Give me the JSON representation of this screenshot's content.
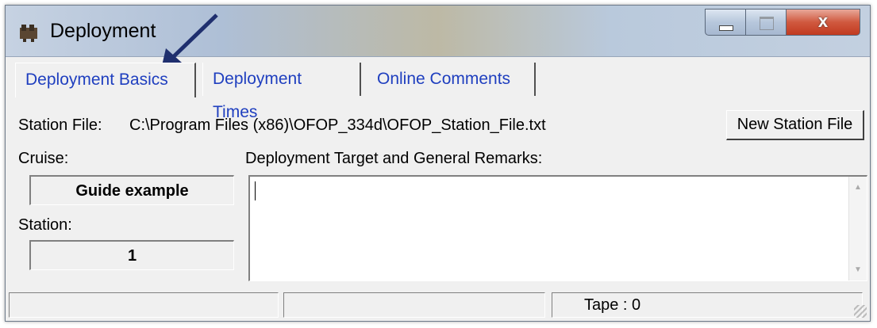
{
  "window": {
    "title": "Deployment",
    "controls": {
      "minimize": "minimize",
      "maximize": "maximize",
      "close": "x"
    }
  },
  "tabs": [
    {
      "label": "Deployment Basics",
      "active": true
    },
    {
      "label": "Deployment Times",
      "active": false
    },
    {
      "label": "Online Comments",
      "active": false
    }
  ],
  "station_file": {
    "label": "Station File:",
    "path": "C:\\Program Files (x86)\\OFOP_334d\\OFOP_Station_File.txt",
    "button": "New Station File"
  },
  "cruise": {
    "label": "Cruise:",
    "value": "Guide example"
  },
  "station": {
    "label": "Station:",
    "value": "1"
  },
  "remarks": {
    "label": "Deployment Target and General Remarks:",
    "value": ""
  },
  "statusbar": {
    "panel1": "",
    "panel2": "",
    "tape": "Tape : 0"
  },
  "colors": {
    "tab_text": "#1f3fbf",
    "arrow": "#1f2f6e",
    "close_button": "#c8472c"
  },
  "icons": {
    "app": "deployment-app-icon",
    "annotation": "pointer-arrow-icon"
  }
}
